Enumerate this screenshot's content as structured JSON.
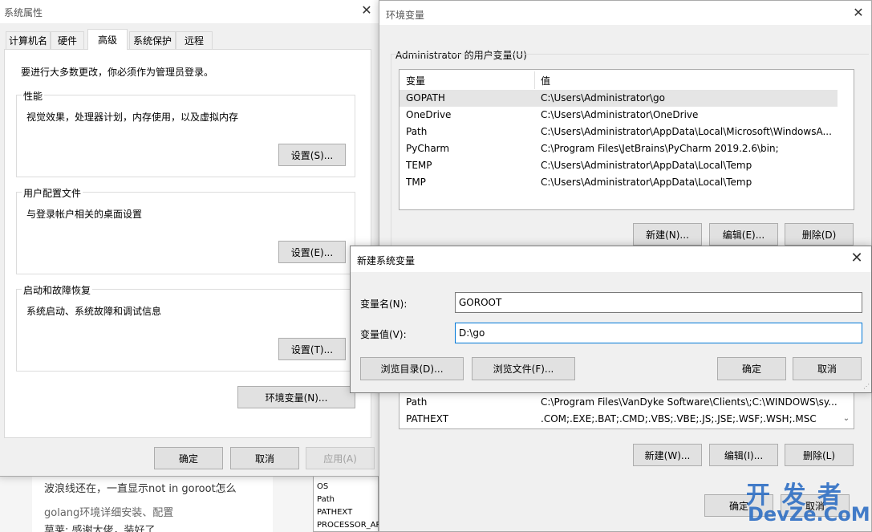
{
  "background_page": {
    "comment_line1": "波浪线还在，一直显示not in goroot怎么",
    "comment_link": "golang环境详细安装、配置",
    "comment_line3": "莫莱: 感谢大佬，装好了",
    "list_items": [
      "OS",
      "Path",
      "PATHEXT",
      "PROCESSOR_AR"
    ]
  },
  "sysprops": {
    "title": "系统属性",
    "tabs": [
      "计算机名",
      "硬件",
      "高级",
      "系统保护",
      "远程"
    ],
    "admin_note": "要进行大多数更改，你必须作为管理员登录。",
    "performance": {
      "label": "性能",
      "desc": "视觉效果，处理器计划，内存使用，以及虚拟内存",
      "button": "设置(S)..."
    },
    "profiles": {
      "label": "用户配置文件",
      "desc": "与登录帐户相关的桌面设置",
      "button": "设置(E)..."
    },
    "startup": {
      "label": "启动和故障恢复",
      "desc": "系统启动、系统故障和调试信息",
      "button": "设置(T)..."
    },
    "env_button": "环境变量(N)...",
    "ok": "确定",
    "cancel": "取消",
    "apply": "应用(A)"
  },
  "envvars": {
    "title": "环境变量",
    "user_group_label": "Administrator 的用户变量(U)",
    "columns": [
      "变量",
      "值"
    ],
    "user_vars": [
      {
        "name": "GOPATH",
        "value": "C:\\Users\\Administrator\\go"
      },
      {
        "name": "OneDrive",
        "value": "C:\\Users\\Administrator\\OneDrive"
      },
      {
        "name": "Path",
        "value": "C:\\Users\\Administrator\\AppData\\Local\\Microsoft\\WindowsA..."
      },
      {
        "name": "PyCharm",
        "value": "C:\\Program Files\\JetBrains\\PyCharm 2019.2.6\\bin;"
      },
      {
        "name": "TEMP",
        "value": "C:\\Users\\Administrator\\AppData\\Local\\Temp"
      },
      {
        "name": "TMP",
        "value": "C:\\Users\\Administrator\\AppData\\Local\\Temp"
      }
    ],
    "user_buttons": {
      "new": "新建(N)...",
      "edit": "编辑(E)...",
      "delete": "删除(D)"
    },
    "system_vars": [
      {
        "name": "Path",
        "value": "C:\\Program Files\\VanDyke Software\\Clients\\;C:\\WINDOWS\\sy..."
      },
      {
        "name": "PATHEXT",
        "value": ".COM;.EXE;.BAT;.CMD;.VBS;.VBE;.JS;.JSE;.WSF;.WSH;.MSC"
      }
    ],
    "system_buttons": {
      "new": "新建(W)...",
      "edit": "编辑(I)...",
      "delete": "删除(L)"
    },
    "ok": "确定",
    "cancel": "取消"
  },
  "newvar": {
    "title": "新建系统变量",
    "name_label": "变量名(N):",
    "name_value": "GOROOT",
    "value_label": "变量值(V):",
    "value_value": "D:\\go",
    "browse_dir": "浏览目录(D)...",
    "browse_file": "浏览文件(F)...",
    "ok": "确定",
    "cancel": "取消"
  },
  "watermark": {
    "line1": "开 发 者",
    "line2": "DevZe.CoM"
  },
  "colors": {
    "selected_row": "#e5e5e5",
    "focus_border": "#0078d7",
    "watermark": "#2f6fc4"
  }
}
